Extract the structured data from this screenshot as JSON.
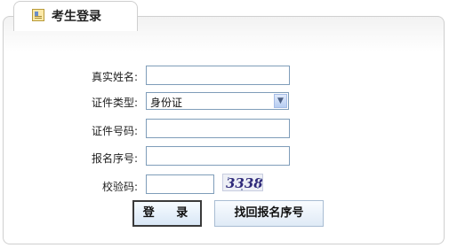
{
  "header": {
    "title": "考生登录"
  },
  "form": {
    "name_label": "真实姓名:",
    "idtype_label": "证件类型:",
    "idtype_value": "身份证",
    "idnumber_label": "证件号码:",
    "regnumber_label": "报名序号:",
    "captcha_label": "校验码:",
    "captcha_text": "3338"
  },
  "buttons": {
    "login": "登 录",
    "recover": "找回报名序号"
  }
}
